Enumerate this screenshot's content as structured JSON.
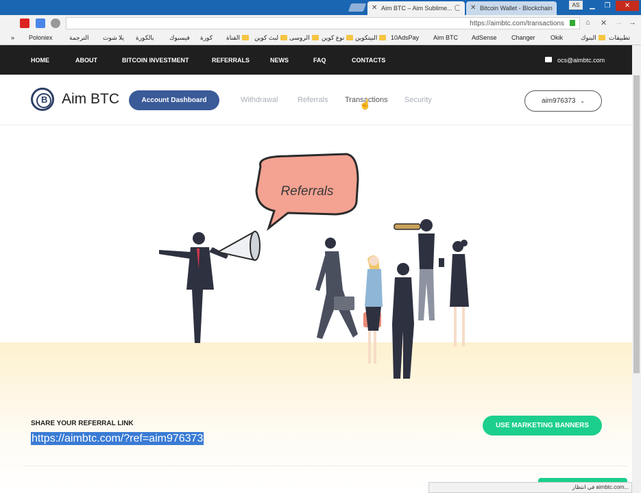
{
  "browser": {
    "tabs": [
      {
        "title": "Aim BTC – Aim Sublime...",
        "active": true,
        "loading": true
      },
      {
        "title": "Bitcoin Wallet - Blockchain",
        "active": false
      }
    ],
    "profile": "AS",
    "url": "https://aimbtc.com/transactions",
    "bookmarks": [
      "Poloniex",
      "الترجمة",
      "يلا شوت",
      "بالكورة",
      "فيسبوك",
      "كورة",
      "القناة",
      "لبث كوين",
      "الروسى",
      "نوع كوين",
      "البيتكوين",
      "10AdsPay",
      "Aim BTC",
      "AdSense",
      "Changer",
      "Okik",
      "البنوك",
      "تطبيقات"
    ],
    "more_label": "»",
    "status_text": "في انتظار aimbtc.com..."
  },
  "nav": {
    "items": [
      "HOME",
      "ABOUT",
      "BITCOIN INVESTMENT",
      "REFERRALS",
      "NEWS",
      "FAQ",
      "CONTACTS"
    ],
    "email": "ocs@aimbtc.com"
  },
  "account": {
    "logo": "Aim BTC",
    "dashboard_label": "Account Dashboard",
    "links": [
      "Withdrawal",
      "Referrals",
      "Transactions",
      "Security"
    ],
    "username": "aim976373"
  },
  "hero": {
    "bubble_text": "Referrals"
  },
  "share": {
    "label": "SHARE YOUR REFERRAL LINK",
    "link": "https://aimbtc.com/?ref=aim976373",
    "banners_label": "USE MARKETING BANNERS"
  },
  "colors": {
    "nav_bg": "#1f1f1f",
    "dashboard_button": "#3a5a98",
    "banners_button": "#1ccf8c",
    "bubble": "#f4a292"
  }
}
